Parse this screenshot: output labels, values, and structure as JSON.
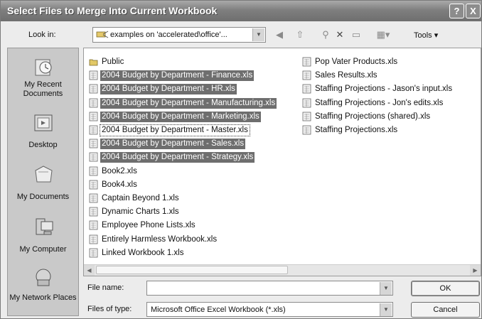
{
  "window": {
    "title": "Select Files to Merge Into Current Workbook",
    "help_label": "?",
    "close_label": "X"
  },
  "lookin": {
    "label": "Look in:",
    "value": "examples on 'accelerated\\office'..."
  },
  "toolbar": {
    "tools_label": "Tools ▾"
  },
  "places": [
    {
      "label": "My Recent Documents",
      "icon": "recent-documents-icon"
    },
    {
      "label": "Desktop",
      "icon": "desktop-icon"
    },
    {
      "label": "My Documents",
      "icon": "my-documents-icon"
    },
    {
      "label": "My Computer",
      "icon": "my-computer-icon"
    },
    {
      "label": "My Network Places",
      "icon": "network-places-icon"
    }
  ],
  "files": {
    "column1": [
      {
        "name": "Public",
        "type": "folder",
        "selected": false
      },
      {
        "name": "2004 Budget by Department - Finance.xls",
        "type": "xls",
        "selected": true
      },
      {
        "name": "2004 Budget by Department - HR.xls",
        "type": "xls",
        "selected": true
      },
      {
        "name": "2004 Budget by Department - Manufacturing.xls",
        "type": "xls",
        "selected": true
      },
      {
        "name": "2004 Budget by Department - Marketing.xls",
        "type": "xls",
        "selected": true
      },
      {
        "name": "2004 Budget by Department - Master.xls",
        "type": "xls",
        "selected": false,
        "focused": true
      },
      {
        "name": "2004 Budget by Department - Sales.xls",
        "type": "xls",
        "selected": true
      },
      {
        "name": "2004 Budget by Department - Strategy.xls",
        "type": "xls",
        "selected": true
      },
      {
        "name": "Book2.xls",
        "type": "xls",
        "selected": false
      },
      {
        "name": "Book4.xls",
        "type": "xls",
        "selected": false
      },
      {
        "name": "Captain Beyond 1.xls",
        "type": "xls",
        "selected": false
      },
      {
        "name": "Dynamic Charts 1.xls",
        "type": "xls",
        "selected": false
      },
      {
        "name": "Employee Phone Lists.xls",
        "type": "xls",
        "selected": false
      },
      {
        "name": "Entirely Harmless Workbook.xls",
        "type": "xls",
        "selected": false
      },
      {
        "name": "Linked Workbook 1.xls",
        "type": "xls",
        "selected": false
      }
    ],
    "column2": [
      {
        "name": "Pop Vater Products.xls",
        "type": "xls",
        "selected": false
      },
      {
        "name": "Sales Results.xls",
        "type": "xls",
        "selected": false
      },
      {
        "name": "Staffing Projections - Jason's input.xls",
        "type": "xls",
        "selected": false
      },
      {
        "name": "Staffing Projections - Jon's edits.xls",
        "type": "xls",
        "selected": false
      },
      {
        "name": "Staffing Projections (shared).xls",
        "type": "xls",
        "selected": false
      },
      {
        "name": "Staffing Projections.xls",
        "type": "xls",
        "selected": false
      }
    ]
  },
  "filename": {
    "label": "File name:",
    "value": ""
  },
  "filetype": {
    "label": "Files of type:",
    "value": "Microsoft Office Excel Workbook (*.xls)"
  },
  "buttons": {
    "ok": "OK",
    "cancel": "Cancel"
  },
  "colors": {
    "titlebar": "#7f7f7f",
    "selection": "#6e6e6e",
    "places_bg": "#c9c9c9"
  }
}
